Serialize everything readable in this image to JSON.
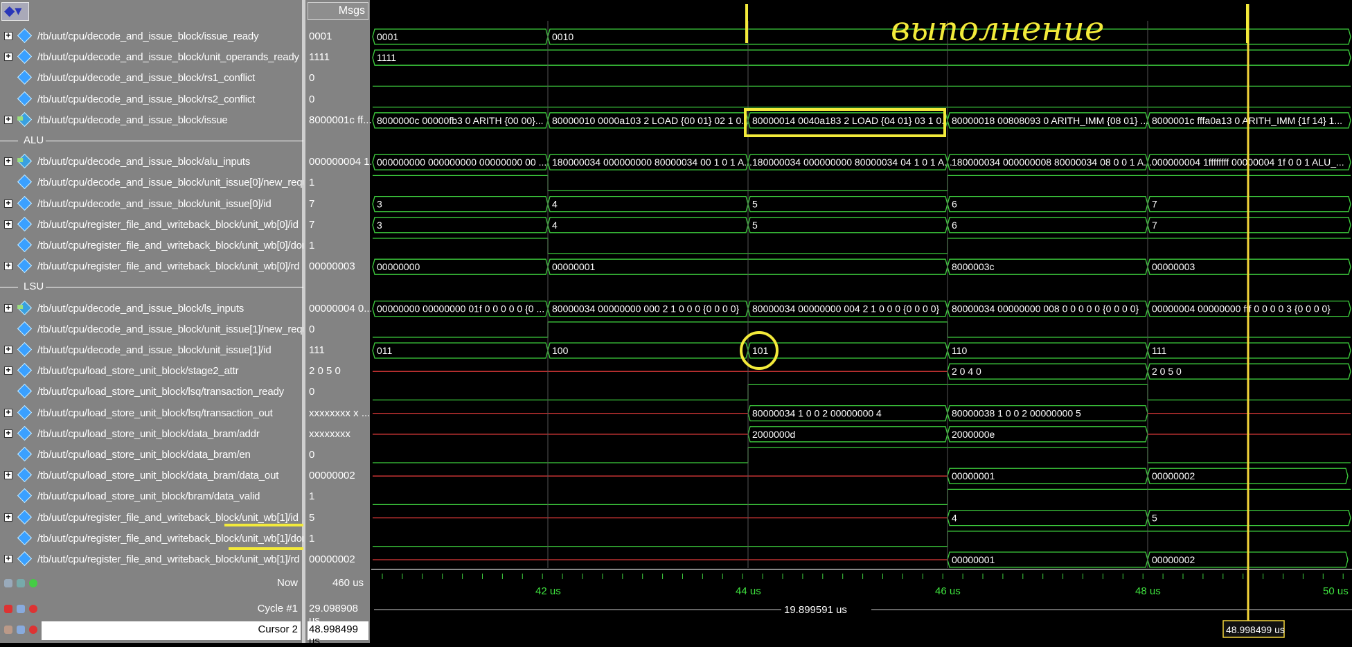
{
  "header": {
    "toolbar_icon": "layers-icon",
    "msgs_label": "Msgs"
  },
  "signals": [
    {
      "path": "/tb/uut/cpu/decode_and_issue_block/issue_ready",
      "value": "0001",
      "expand": true,
      "kind": "bus"
    },
    {
      "path": "/tb/uut/cpu/decode_and_issue_block/unit_operands_ready",
      "value": "1111",
      "expand": true,
      "kind": "bus"
    },
    {
      "path": "/tb/uut/cpu/decode_and_issue_block/rs1_conflict",
      "value": "0",
      "expand": false,
      "kind": "bit"
    },
    {
      "path": "/tb/uut/cpu/decode_and_issue_block/rs2_conflict",
      "value": "0",
      "expand": false,
      "kind": "bit"
    },
    {
      "path": "/tb/uut/cpu/decode_and_issue_block/issue",
      "value": "8000001c ff...",
      "expand": true,
      "kind": "struct"
    },
    {
      "divider": "ALU"
    },
    {
      "path": "/tb/uut/cpu/decode_and_issue_block/alu_inputs",
      "value": "000000004 1...",
      "expand": true,
      "kind": "struct"
    },
    {
      "path": "/tb/uut/cpu/decode_and_issue_block/unit_issue[0]/new_request",
      "value": "1",
      "expand": false,
      "kind": "bit"
    },
    {
      "path": "/tb/uut/cpu/decode_and_issue_block/unit_issue[0]/id",
      "value": "7",
      "expand": true,
      "kind": "bus"
    },
    {
      "path": "/tb/uut/cpu/register_file_and_writeback_block/unit_wb[0]/id",
      "value": "7",
      "expand": true,
      "kind": "bus"
    },
    {
      "path": "/tb/uut/cpu/register_file_and_writeback_block/unit_wb[0]/done",
      "value": "1",
      "expand": false,
      "kind": "bit"
    },
    {
      "path": "/tb/uut/cpu/register_file_and_writeback_block/unit_wb[0]/rd",
      "value": "00000003",
      "expand": true,
      "kind": "bus"
    },
    {
      "divider": "LSU"
    },
    {
      "path": "/tb/uut/cpu/decode_and_issue_block/ls_inputs",
      "value": "00000004 0...",
      "expand": true,
      "kind": "struct"
    },
    {
      "path": "/tb/uut/cpu/decode_and_issue_block/unit_issue[1]/new_request",
      "value": "0",
      "expand": false,
      "kind": "bit"
    },
    {
      "path": "/tb/uut/cpu/decode_and_issue_block/unit_issue[1]/id",
      "value": "111",
      "expand": true,
      "kind": "bus"
    },
    {
      "path": "/tb/uut/cpu/load_store_unit_block/stage2_attr",
      "value": "2 0 5 0",
      "expand": true,
      "kind": "bus"
    },
    {
      "path": "/tb/uut/cpu/load_store_unit_block/lsq/transaction_ready",
      "value": "0",
      "expand": false,
      "kind": "bit"
    },
    {
      "path": "/tb/uut/cpu/load_store_unit_block/lsq/transaction_out",
      "value": "xxxxxxxx x ...",
      "expand": true,
      "kind": "bus"
    },
    {
      "path": "/tb/uut/cpu/load_store_unit_block/data_bram/addr",
      "value": "xxxxxxxx",
      "expand": true,
      "kind": "bus"
    },
    {
      "path": "/tb/uut/cpu/load_store_unit_block/data_bram/en",
      "value": "0",
      "expand": false,
      "kind": "bit"
    },
    {
      "path": "/tb/uut/cpu/load_store_unit_block/data_bram/data_out",
      "value": "00000002",
      "expand": true,
      "kind": "bus"
    },
    {
      "path": "/tb/uut/cpu/load_store_unit_block/bram/data_valid",
      "value": "1",
      "expand": false,
      "kind": "bit"
    },
    {
      "path": "/tb/uut/cpu/register_file_and_writeback_block/unit_wb[1]/id",
      "value": "5",
      "expand": true,
      "kind": "bus"
    },
    {
      "path": "/tb/uut/cpu/register_file_and_writeback_block/unit_wb[1]/done",
      "value": "1",
      "expand": false,
      "kind": "bit"
    },
    {
      "path": "/tb/uut/cpu/register_file_and_writeback_block/unit_wb[1]/rd",
      "value": "00000002",
      "expand": true,
      "kind": "bus"
    }
  ],
  "waves": {
    "issue_ready": [
      "0001",
      "0010"
    ],
    "unit_operands_ready": [
      "1111"
    ],
    "issue": [
      "8000000c 00000fb3 0 ARITH {00 00}...",
      "80000010 0000a103 2 LOAD {00 01} 02 1 0...",
      "80000014 0040a183 2 LOAD {04 01} 03 1 0...",
      "80000018 00808093 0 ARITH_IMM {08 01} ...",
      "8000001c fffa0a13 0 ARITH_IMM {1f 14} 1..."
    ],
    "alu_inputs": [
      "000000000 000000000 00000000 00 ...",
      "180000034 000000000 80000034 00 1 0 1 A...",
      "180000034 000000000 80000034 04 1 0 1 A...",
      "180000034 000000008 80000034 08 0 0 1 A...",
      "000000004 1ffffffff 00000004 1f 0 0 1 ALU_..."
    ],
    "unit_issue0_id": [
      "3",
      "4",
      "5",
      "6",
      "7"
    ],
    "unit_wb0_id": [
      "3",
      "4",
      "5",
      "6",
      "7"
    ],
    "unit_wb0_rd": [
      "00000000",
      "00000001",
      "8000003c",
      "00000003"
    ],
    "ls_inputs": [
      "00000000 00000000 01f 0 0 0 0 0 {0 ...",
      "80000034 00000000 000 2 1 0 0 0 {0 0 0 0}",
      "80000034 00000000 004 2 1 0 0 0 {0 0 0 0}",
      "80000034 00000000 008 0 0 0 0 0 {0 0 0 0}",
      "00000004 00000000 fff 0 0 0 0 3 {0 0 0 0}"
    ],
    "unit_issue1_id": [
      "011",
      "100",
      "101",
      "110",
      "111"
    ],
    "stage2_attr": [
      "2 0 4 0",
      "2 0 5 0"
    ],
    "transaction_out": [
      "80000034 1 0 0 2 00000000 4",
      "80000038 1 0 0 2 00000000 5"
    ],
    "bram_addr": [
      "2000000d",
      "2000000e"
    ],
    "bram_data_out": [
      "00000001",
      "00000002"
    ],
    "unit_wb1_id": [
      "4",
      "5"
    ],
    "unit_wb1_rd": [
      "00000001",
      "00000002"
    ]
  },
  "timeline": {
    "ticks": [
      "42 us",
      "44 us",
      "46 us",
      "48 us",
      "50 us"
    ],
    "delta_label": "19.899591 us",
    "cursor_label": "48.998499 us"
  },
  "bottom": {
    "now_label": "Now",
    "now_value": "460 us",
    "cycle_label": "Cycle #1",
    "cycle_value": "29.098908 us",
    "cursor_label": "Cursor 2",
    "cursor_value": "48.998499 us"
  },
  "annotation": {
    "handwritten": "выполнение"
  },
  "colors": {
    "wave": "#3ecf3e",
    "undefined": "#e03a3a",
    "cursor": "#f4d53a",
    "annotation": "#f3ea3a"
  }
}
